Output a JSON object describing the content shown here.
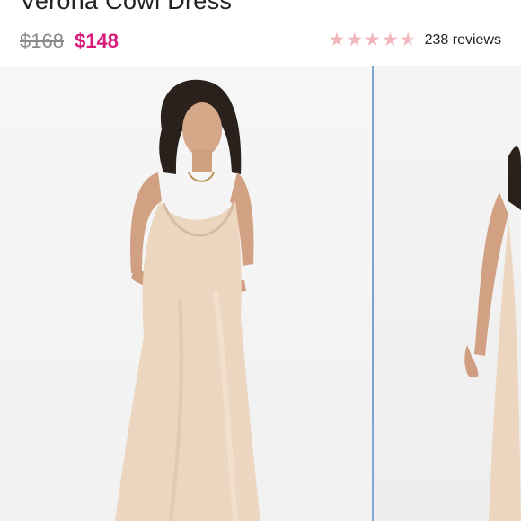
{
  "product": {
    "title": "Verona Cowl Dress",
    "original_price": "$168",
    "sale_price": "$148"
  },
  "rating": {
    "stars": 4.5,
    "reviews_label": "238 reviews"
  },
  "colors": {
    "sale": "#d81b7a",
    "star": "#f2b6bd",
    "divider": "#7aa6d6"
  },
  "gallery": {
    "images": [
      "product-photo-front",
      "product-photo-back"
    ]
  }
}
